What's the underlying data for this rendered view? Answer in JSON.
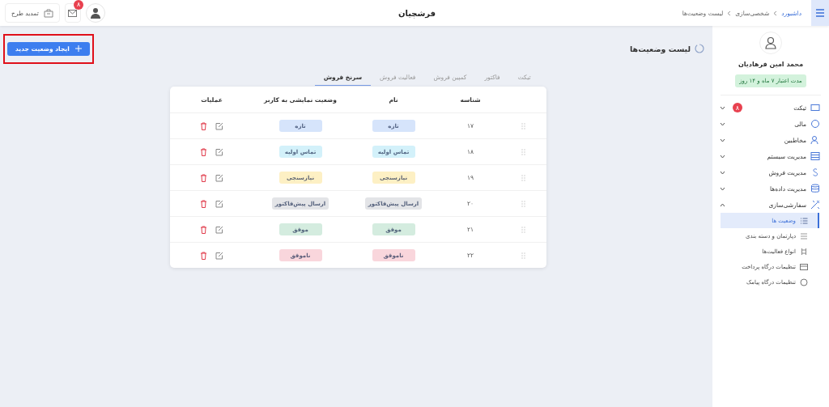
{
  "header": {
    "breadcrumb": [
      "داشبورد",
      "شخصی‌سازی",
      "لیست وضعیت‌ها"
    ],
    "brand": "فرشچیان",
    "renew_button": "تمدید طرح",
    "mail_badge": "۸"
  },
  "sidebar": {
    "user_name": "محمد امین فرهادیان",
    "subscription": "مدت اعتبار ۷ ماه و ۱۴ روز",
    "items": [
      {
        "label": "تیکت",
        "badge": "۸",
        "expanded": false
      },
      {
        "label": "مالی",
        "expanded": false
      },
      {
        "label": "مخاطبین",
        "expanded": false
      },
      {
        "label": "مدیریت سیستم",
        "expanded": false
      },
      {
        "label": "مدیریت فروش",
        "expanded": false
      },
      {
        "label": "مدیریت داده‌ها",
        "expanded": false
      },
      {
        "label": "سفارشی‌سازی",
        "expanded": true,
        "children": [
          {
            "label": "وضعیت ها",
            "selected": true
          },
          {
            "label": "دپارتمان و دسته بندی",
            "selected": false
          },
          {
            "label": "انواع فعالیت‌ها",
            "selected": false
          },
          {
            "label": "تنظیمات درگاه پرداخت",
            "selected": false
          },
          {
            "label": "تنظیمات درگاه پیامک",
            "selected": false
          }
        ]
      }
    ]
  },
  "page": {
    "title": "لیست وضعیت‌ها",
    "create_button": {
      "label": "ایجاد وضعیت جدید",
      "highlighted": true
    }
  },
  "tabs": [
    {
      "label": "تیکت",
      "selected": false
    },
    {
      "label": "فاکتور",
      "selected": false
    },
    {
      "label": "کمپین فروش",
      "selected": false
    },
    {
      "label": "فعالیت فروش",
      "selected": false
    },
    {
      "label": "سرنخ فروش",
      "selected": true
    }
  ],
  "table": {
    "columns": [
      "شناسه",
      "نام",
      "وضعیت نمایشی به کاربر",
      "عملیات"
    ],
    "rows": [
      {
        "id": "۱۷",
        "name": "تازه",
        "display": "تازه",
        "color": "#d6e4fb"
      },
      {
        "id": "۱۸",
        "name": "تماس اولیه",
        "display": "تماس اولیه",
        "color": "#d3f1fa"
      },
      {
        "id": "۱۹",
        "name": "نیازسنجی",
        "display": "نیازسنجی",
        "color": "#fdf0c4"
      },
      {
        "id": "۲۰",
        "name": "ارسال پیش‌فاکتور",
        "display": "ارسال پیش‌فاکتور",
        "color": "#e3e4e7"
      },
      {
        "id": "۲۱",
        "name": "موفق",
        "display": "موفق",
        "color": "#d4ecdf"
      },
      {
        "id": "۲۲",
        "name": "ناموفق",
        "display": "ناموفق",
        "color": "#f9d6dc"
      }
    ]
  }
}
